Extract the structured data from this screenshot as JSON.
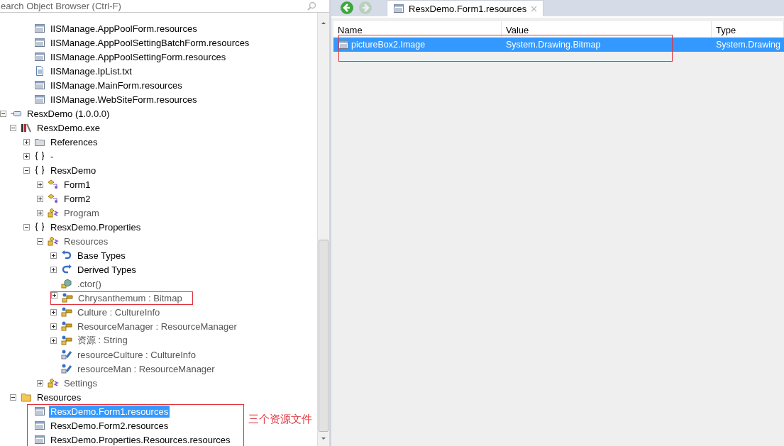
{
  "search": {
    "placeholder": "earch Object Browser (Ctrl-F)"
  },
  "tree": {
    "leading_items": [
      {
        "label": "IISManage.AppPoolForm.resources",
        "kind": "resource",
        "dimmed": false,
        "selected": false
      },
      {
        "label": "IISManage.AppPoolSettingBatchForm.resources",
        "kind": "resource",
        "dimmed": false,
        "selected": false
      },
      {
        "label": "IISManage.AppPoolSettingForm.resources",
        "kind": "resource",
        "dimmed": false,
        "selected": false
      },
      {
        "label": "IISManage.IpList.txt",
        "kind": "textfile",
        "dimmed": false,
        "selected": false
      },
      {
        "label": "IISManage.MainForm.resources",
        "kind": "resource",
        "dimmed": false,
        "selected": false
      },
      {
        "label": "IISManage.WebSiteForm.resources",
        "kind": "resource",
        "dimmed": false,
        "selected": false
      }
    ],
    "nodes": [
      {
        "label": "ResxDemo (1.0.0.0)",
        "kind": "assembly",
        "expanded": true,
        "dimmed": false,
        "selected": false,
        "children": [
          {
            "label": "ResxDemo.exe",
            "kind": "library",
            "expanded": true,
            "dimmed": false,
            "selected": false,
            "children": [
              {
                "label": "References",
                "kind": "references",
                "expanded": false,
                "dimmed": false,
                "selected": false
              },
              {
                "label": "-",
                "kind": "namespace",
                "expanded": false,
                "dimmed": false,
                "selected": false
              },
              {
                "label": "ResxDemo",
                "kind": "namespace",
                "expanded": true,
                "dimmed": false,
                "selected": false,
                "children": [
                  {
                    "label": "Form1",
                    "kind": "form",
                    "expanded": false,
                    "dimmed": false,
                    "selected": false
                  },
                  {
                    "label": "Form2",
                    "kind": "form",
                    "expanded": false,
                    "dimmed": false,
                    "selected": false
                  },
                  {
                    "label": "Program",
                    "kind": "class",
                    "expanded": false,
                    "dimmed": true,
                    "selected": false
                  }
                ]
              },
              {
                "label": "ResxDemo.Properties",
                "kind": "namespace",
                "expanded": true,
                "dimmed": false,
                "selected": false,
                "children": [
                  {
                    "label": "Resources",
                    "kind": "class",
                    "expanded": true,
                    "dimmed": true,
                    "selected": false,
                    "children": [
                      {
                        "label": "Base Types",
                        "kind": "basetypes",
                        "expanded": false,
                        "dimmed": false,
                        "selected": false
                      },
                      {
                        "label": "Derived Types",
                        "kind": "derivedtypes",
                        "expanded": false,
                        "dimmed": false,
                        "selected": false
                      },
                      {
                        "label": ".ctor()",
                        "kind": "method",
                        "dimmed": true,
                        "selected": false
                      },
                      {
                        "label": "Chrysanthemum : Bitmap",
                        "kind": "property",
                        "expanded": false,
                        "dimmed": true,
                        "selected": false,
                        "annotated": true
                      },
                      {
                        "label": "Culture : CultureInfo",
                        "kind": "property",
                        "expanded": false,
                        "dimmed": true,
                        "selected": false
                      },
                      {
                        "label": "ResourceManager : ResourceManager",
                        "kind": "property",
                        "expanded": false,
                        "dimmed": true,
                        "selected": false
                      },
                      {
                        "label": "资源 : String",
                        "kind": "property",
                        "expanded": false,
                        "dimmed": true,
                        "selected": false
                      },
                      {
                        "label": "resourceCulture : CultureInfo",
                        "kind": "field",
                        "dimmed": true,
                        "selected": false
                      },
                      {
                        "label": "resourceMan : ResourceManager",
                        "kind": "field",
                        "dimmed": true,
                        "selected": false
                      }
                    ]
                  },
                  {
                    "label": "Settings",
                    "kind": "class",
                    "expanded": false,
                    "dimmed": true,
                    "selected": false
                  }
                ]
              }
            ]
          },
          {
            "label": "Resources",
            "kind": "folder",
            "expanded": true,
            "dimmed": false,
            "selected": false,
            "children_note": "三个资源文件",
            "children": [
              {
                "label": "ResxDemo.Form1.resources",
                "kind": "resource",
                "dimmed": false,
                "selected": true
              },
              {
                "label": "ResxDemo.Form2.resources",
                "kind": "resource",
                "dimmed": false,
                "selected": false
              },
              {
                "label": "ResxDemo.Properties.Resources.resources",
                "kind": "resource",
                "dimmed": false,
                "selected": false
              }
            ]
          }
        ]
      }
    ]
  },
  "tabs": [
    {
      "label": "ResxDemo.Form1.resources",
      "selected": true
    }
  ],
  "table": {
    "columns": [
      "Name",
      "Value",
      "Type"
    ],
    "rows": [
      {
        "cells": [
          "pictureBox2.Image",
          "System.Drawing.Bitmap",
          "System.Drawing"
        ],
        "selected": true,
        "annotated": true
      }
    ]
  }
}
